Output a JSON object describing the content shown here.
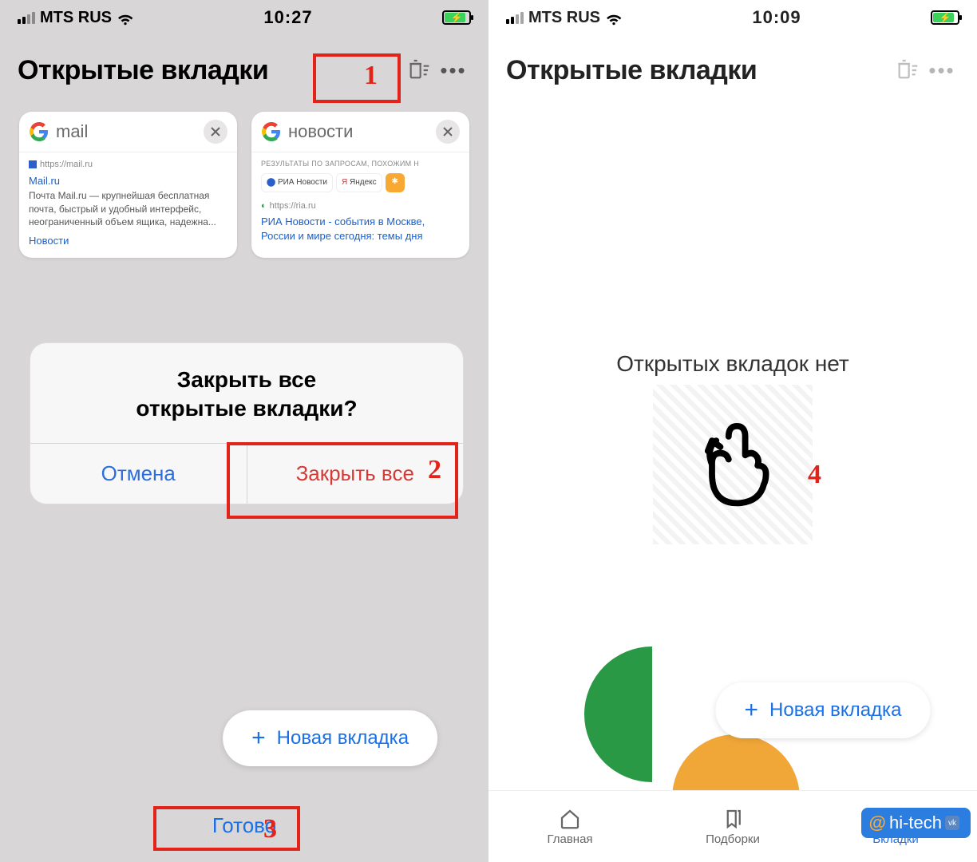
{
  "left": {
    "status": {
      "carrier": "MTS RUS",
      "time": "10:27"
    },
    "header": {
      "title": "Открытые вкладки"
    },
    "tabs": [
      {
        "title": "mail",
        "url_label": "https://mail.ru",
        "link": "Mail.ru",
        "snippet": "Почта Mail.ru — крупнейшая бесплатная почта, быстрый и удобный интерфейс, неограниченный объем ящика, надежна...",
        "sublink": "Новости"
      },
      {
        "title": "новости",
        "results_header": "РЕЗУЛЬТАТЫ ПО ЗАПРОСАМ, ПОХОЖИМ Н",
        "chip1_brand": "РИА",
        "chip1_sub": "Новости",
        "chip2": "Яндекс",
        "url_label": "https://ria.ru",
        "link": "РИА Новости - события в Москве, России и мире сегодня: темы дня"
      }
    ],
    "dialog": {
      "title_line1": "Закрыть все",
      "title_line2": "открытые вкладки?",
      "cancel": "Отмена",
      "confirm": "Закрыть все"
    },
    "newtab": "Новая вкладка",
    "done": "Готово"
  },
  "right": {
    "status": {
      "carrier": "MTS RUS",
      "time": "10:09"
    },
    "header": {
      "title": "Открытые вкладки"
    },
    "empty": "Открытых вкладок нет",
    "newtab": "Новая вкладка",
    "nav": {
      "home": "Главная",
      "collections": "Подборки",
      "tabs": "Вкладки"
    }
  },
  "annotations": {
    "n1": "1",
    "n2": "2",
    "n3": "3",
    "n4": "4"
  },
  "watermark": {
    "at": "@",
    "text": "hi-tech",
    "badge": "vk"
  }
}
